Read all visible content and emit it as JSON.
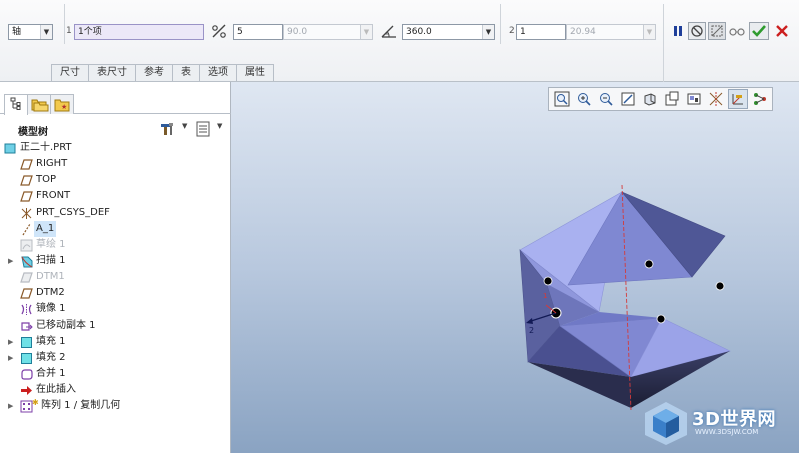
{
  "dashboard": {
    "reference_type": "轴",
    "collector_index": "1",
    "collector_value": "1个项",
    "field_a": "5",
    "field_b": "90.0",
    "angle_value": "360.0",
    "count_index": "2",
    "count_value": "1",
    "field_c": "20.94",
    "tabs": [
      "尺寸",
      "表尺寸",
      "参考",
      "表",
      "选项",
      "属性"
    ]
  },
  "model_tree": {
    "title": "模型树",
    "items": [
      {
        "label": "正二十.PRT",
        "icon": "part-icon",
        "style": "normal"
      },
      {
        "label": "RIGHT",
        "icon": "datum-plane-icon",
        "style": "normal"
      },
      {
        "label": "TOP",
        "icon": "datum-plane-icon",
        "style": "normal"
      },
      {
        "label": "FRONT",
        "icon": "datum-plane-icon",
        "style": "normal"
      },
      {
        "label": "PRT_CSYS_DEF",
        "icon": "csys-icon",
        "style": "normal"
      },
      {
        "label": "A_1",
        "icon": "datum-axis-icon",
        "style": "selected"
      },
      {
        "label": "草绘 1",
        "icon": "sketch-icon",
        "style": "grey"
      },
      {
        "label": "扫描 1",
        "icon": "sweep-icon",
        "style": "normal"
      },
      {
        "label": "DTM1",
        "icon": "datum-plane-icon",
        "style": "grey"
      },
      {
        "label": "DTM2",
        "icon": "datum-plane-icon",
        "style": "normal"
      },
      {
        "label": "镜像 1",
        "icon": "mirror-icon",
        "style": "normal"
      },
      {
        "label": "已移动副本 1",
        "icon": "moved-copy-icon",
        "style": "normal"
      },
      {
        "label": "填充 1",
        "icon": "fill-icon",
        "style": "normal"
      },
      {
        "label": "填充 2",
        "icon": "fill-icon",
        "style": "normal"
      },
      {
        "label": "合并 1",
        "icon": "merge-icon",
        "style": "normal"
      },
      {
        "label": "在此插入",
        "icon": "insert-here-arrow-icon",
        "style": "normal"
      },
      {
        "label": "阵列 1 / 复制几何",
        "icon": "pattern-icon",
        "style": "normal"
      }
    ]
  },
  "graphics": {
    "label_1": "1",
    "label_2": "2"
  },
  "watermark": {
    "name": "3D世界网",
    "url": "WWW.3DSJW.COM"
  },
  "colors": {
    "confirm": "#2e9b2e",
    "cancel": "#cc1f1f",
    "pause": "#1f3f9a",
    "selection": "#cfe5f9",
    "surface": "#7f87c9"
  }
}
